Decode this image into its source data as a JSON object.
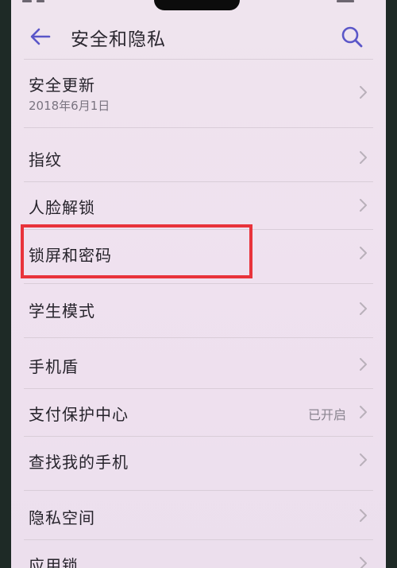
{
  "header": {
    "title": "安全和隐私",
    "back_icon": "arrow-left-icon",
    "search_icon": "search-icon"
  },
  "items": [
    {
      "label": "安全更新",
      "subtitle": "2018年6月1日",
      "status": ""
    },
    {
      "label": "指纹",
      "subtitle": "",
      "status": ""
    },
    {
      "label": "人脸解锁",
      "subtitle": "",
      "status": ""
    },
    {
      "label": "锁屏和密码",
      "subtitle": "",
      "status": ""
    },
    {
      "label": "学生模式",
      "subtitle": "",
      "status": ""
    },
    {
      "label": "手机盾",
      "subtitle": "",
      "status": ""
    },
    {
      "label": "支付保护中心",
      "subtitle": "",
      "status": "已开启"
    },
    {
      "label": "查找我的手机",
      "subtitle": "",
      "status": ""
    },
    {
      "label": "隐私空间",
      "subtitle": "",
      "status": ""
    },
    {
      "label": "应用锁",
      "subtitle": "",
      "status": ""
    }
  ],
  "colors": {
    "highlight": "#e8333b",
    "accent": "#5a56c8",
    "background": "#efe2ef"
  }
}
